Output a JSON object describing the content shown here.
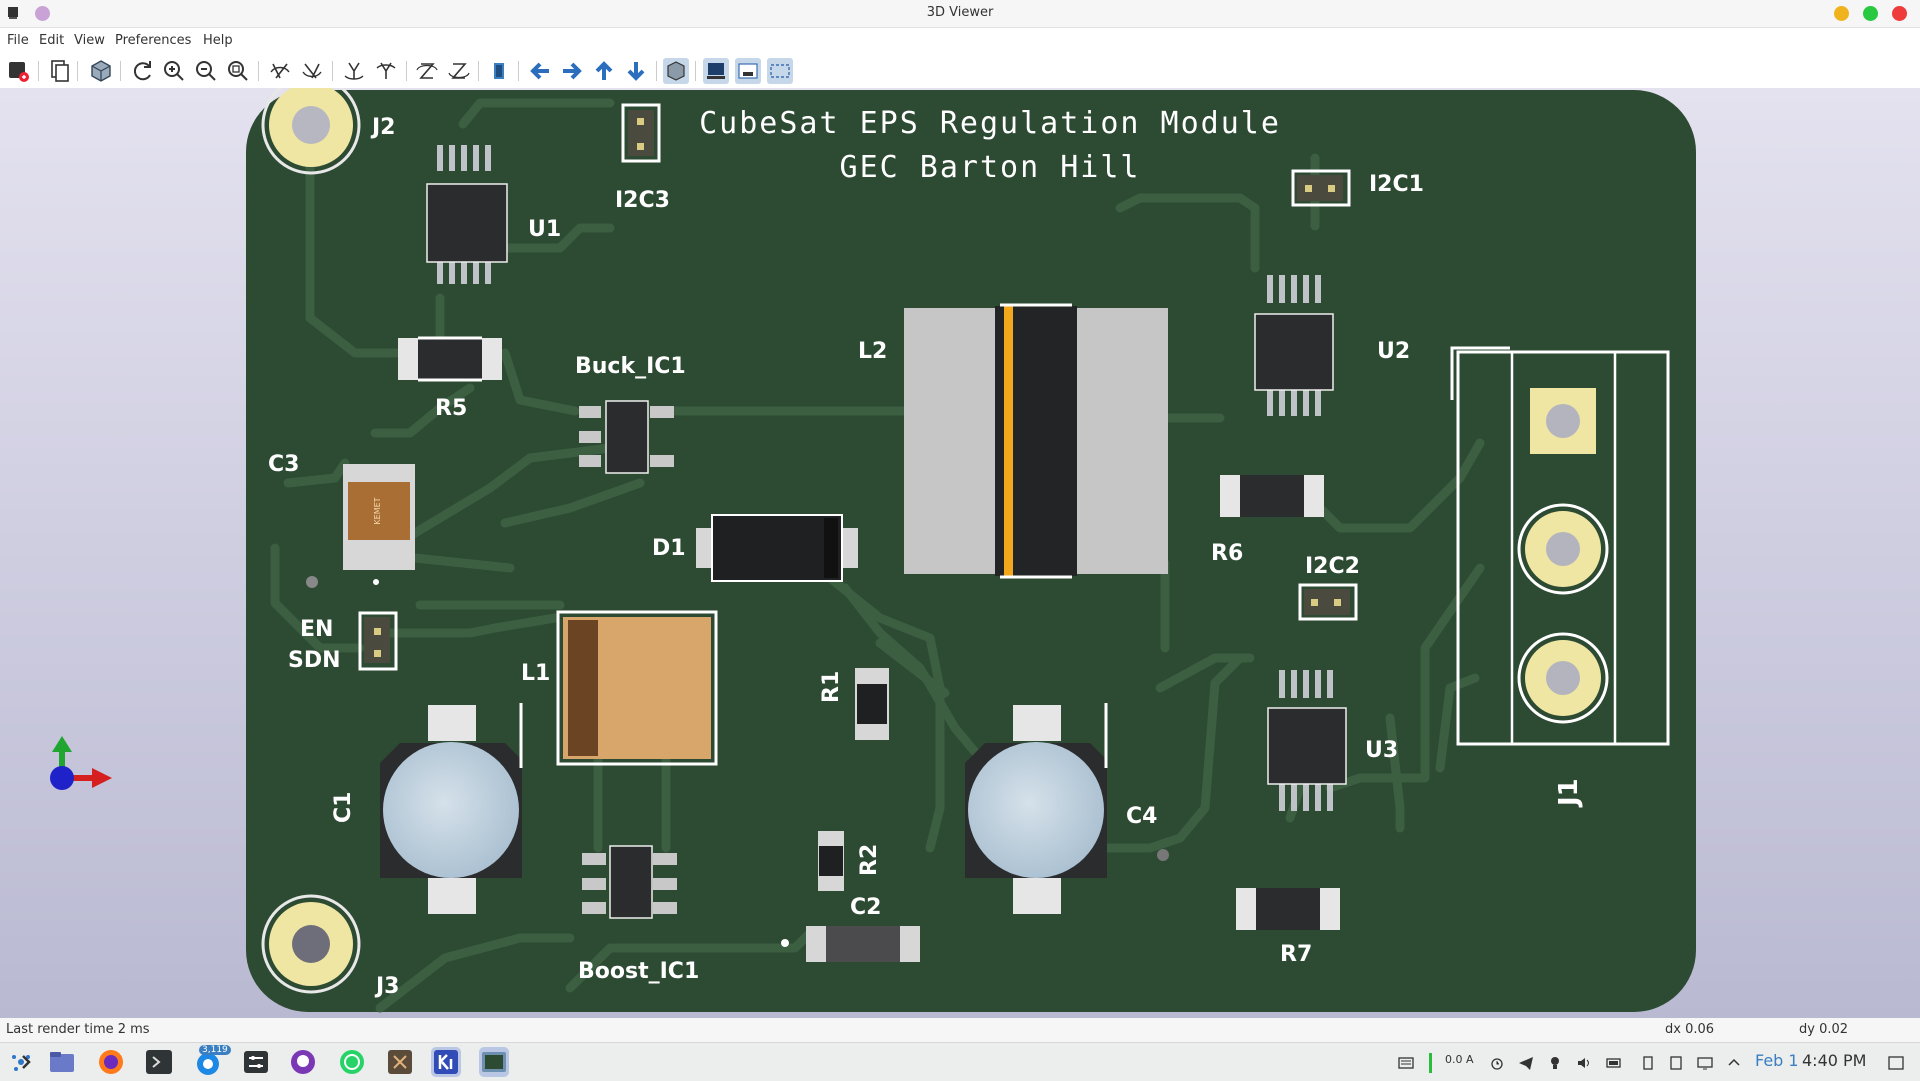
{
  "window": {
    "title": "3D Viewer"
  },
  "menu": {
    "file": "File",
    "edit": "Edit",
    "view": "View",
    "preferences": "Preferences",
    "help": "Help"
  },
  "board": {
    "title_line1": "CubeSat EPS Regulation Module",
    "title_line2": "GEC Barton Hill",
    "labels": {
      "j2": "J2",
      "j3": "J3",
      "j1": "J1",
      "u1": "U1",
      "u2": "U2",
      "u3": "U3",
      "i2c1": "I2C1",
      "i2c2": "I2C2",
      "i2c3": "I2C3",
      "r1": "R1",
      "r2": "R2",
      "r5": "R5",
      "r6": "R6",
      "r7": "R7",
      "c1": "C1",
      "c2": "C2",
      "c3": "C3",
      "c4": "C4",
      "l1": "L1",
      "l2": "L2",
      "d1": "D1",
      "buck": "Buck_IC1",
      "boost": "Boost_IC1",
      "en": "EN",
      "sdn": "SDN",
      "kemet": "KEMET"
    }
  },
  "status": {
    "render_time": "Last render time 2 ms",
    "dx": "dx 0.06",
    "dy": "dy 0.02"
  },
  "tray": {
    "current": "0.0 A",
    "date": "Feb 1",
    "time": "4:40 PM",
    "badge": "3,119"
  },
  "colors": {
    "pcb": "#2d4a33",
    "trace": "#3c5f42",
    "silk": "#ffffff",
    "pad_gold": "#efe6a3"
  }
}
